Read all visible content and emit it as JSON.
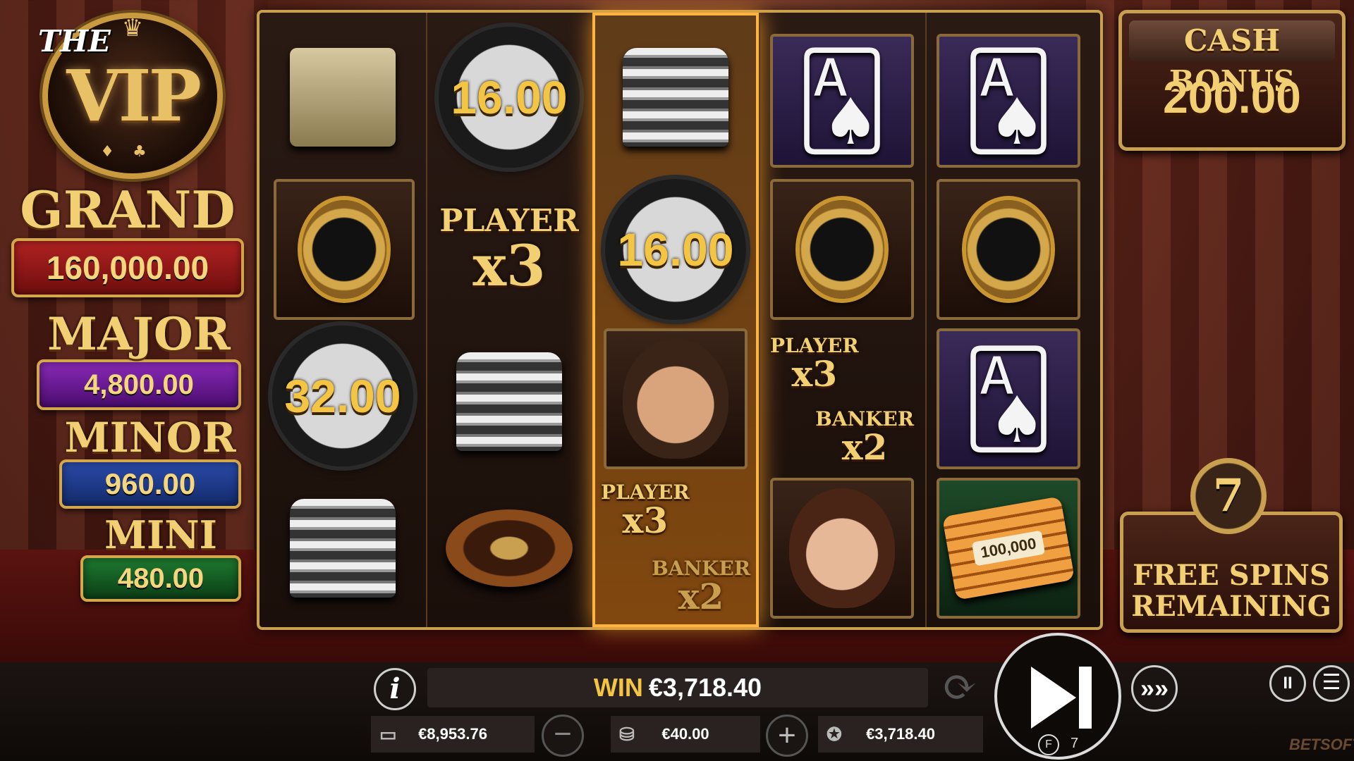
{
  "logo": {
    "prefix": "THE",
    "title": "VIP"
  },
  "jackpots": {
    "grand": {
      "name": "GRAND",
      "value": "160,000.00"
    },
    "major": {
      "name": "MAJOR",
      "value": "4,800.00"
    },
    "minor": {
      "name": "MINOR",
      "value": "960.00"
    },
    "mini": {
      "name": "MINI",
      "value": "480.00"
    }
  },
  "cash_bonus": {
    "title": "CASH BONUS",
    "amount": "200.00"
  },
  "free_spins": {
    "count": "7",
    "label_line1": "FREE SPINS",
    "label_line2": "REMAINING"
  },
  "reels": {
    "r1": {
      "chip": "32.00"
    },
    "r2": {
      "chip": "16.00",
      "mult_label": "PLAYER",
      "mult_value": "x3"
    },
    "r3": {
      "chip": "16.00",
      "mult1_label": "PLAYER",
      "mult1_value": "x3",
      "mult2_label": "BANKER",
      "mult2_value": "x2"
    },
    "r4": {
      "mult1_label": "PLAYER",
      "mult1_value": "x3",
      "mult2_label": "BANKER",
      "mult2_value": "x2"
    },
    "r5": {
      "plaque_label": "100,000"
    }
  },
  "bottom": {
    "win_label": "WIN",
    "win_value": "€3,718.40",
    "balance": "€8,953.76",
    "bet": "€40.00",
    "total_win": "€3,718.40",
    "spin_counter": "7",
    "spin_counter_badge": "F",
    "brand": "BETSOFT"
  },
  "icons": [
    "info-icon",
    "wallet-icon",
    "coins-icon",
    "award-icon",
    "autoplay-icon",
    "play-icon",
    "turbo-icon",
    "pause-icon",
    "menu-icon"
  ],
  "colors": {
    "gold": "#f1cf72",
    "active_reel": "#ffb340",
    "grand": "#b22222",
    "major": "#8a2ab8",
    "minor": "#2a4aa8",
    "mini": "#1e7a30"
  }
}
